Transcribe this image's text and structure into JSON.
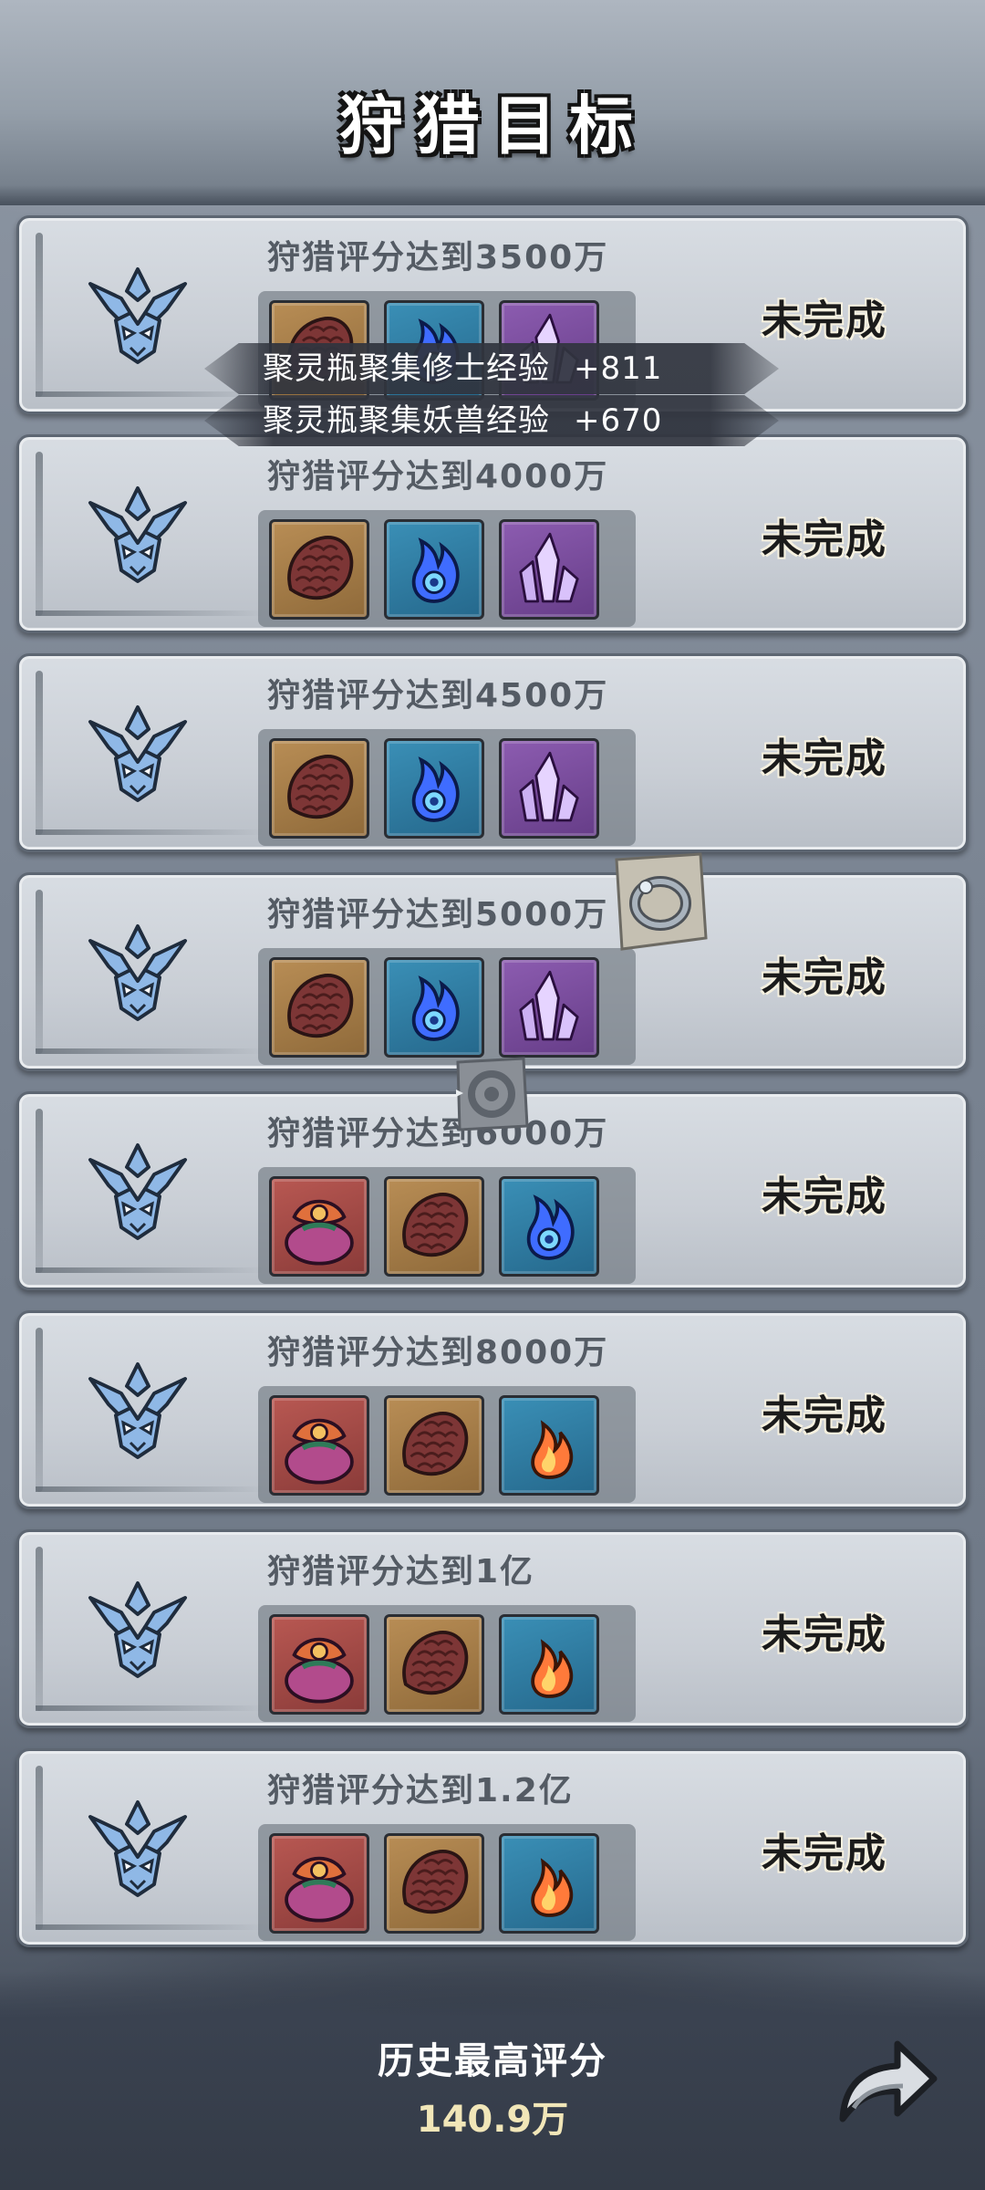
{
  "header": {
    "title": "狩猎目标"
  },
  "targets": [
    {
      "title": "狩猎评分达到3500万",
      "status": "未完成",
      "rewards": [
        "scale-armor",
        "spirit-flame-blue",
        "purple-crystal"
      ]
    },
    {
      "title": "狩猎评分达到4000万",
      "status": "未完成",
      "rewards": [
        "scale-armor",
        "spirit-flame-blue",
        "purple-crystal"
      ]
    },
    {
      "title": "狩猎评分达到4500万",
      "status": "未完成",
      "rewards": [
        "scale-armor",
        "spirit-flame-blue",
        "purple-crystal"
      ]
    },
    {
      "title": "狩猎评分达到5000万",
      "status": "未完成",
      "rewards": [
        "scale-armor",
        "spirit-flame-blue",
        "purple-crystal"
      ]
    },
    {
      "title": "狩猎评分达到6000万",
      "status": "未完成",
      "rewards": [
        "treasure-bag",
        "scale-armor",
        "spirit-flame-blue"
      ]
    },
    {
      "title": "狩猎评分达到8000万",
      "status": "未完成",
      "rewards": [
        "treasure-bag",
        "scale-armor",
        "fire-essence"
      ]
    },
    {
      "title": "狩猎评分达到1亿",
      "status": "未完成",
      "rewards": [
        "treasure-bag",
        "scale-armor",
        "fire-essence"
      ]
    },
    {
      "title": "狩猎评分达到1.2亿",
      "status": "未完成",
      "rewards": [
        "treasure-bag",
        "scale-armor",
        "fire-essence"
      ]
    }
  ],
  "toasts": [
    {
      "text": "聚灵瓶聚集修士经验",
      "value": "+811"
    },
    {
      "text": "聚灵瓶聚集妖兽经验",
      "value": "+670"
    }
  ],
  "floating_items": [
    "ring-icon",
    "gear-token-icon"
  ],
  "footer": {
    "label": "历史最高评分",
    "value": "140.9万",
    "share_icon": "share-arrow-icon"
  },
  "colors": {
    "status_text": "#1b1b1b",
    "card_bg": "#d8dde3",
    "emblem": "#8fb8e6",
    "highlight_value": "#f1e6b8"
  }
}
